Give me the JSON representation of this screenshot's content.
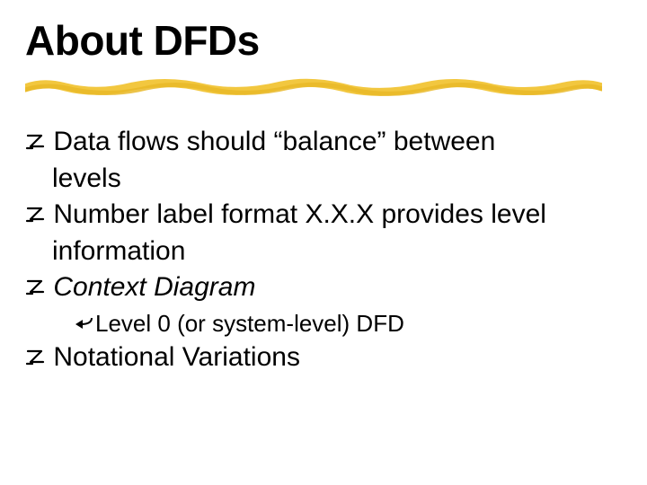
{
  "title": "About DFDs",
  "bullets": [
    {
      "text": "Data flows should “balance” between",
      "indentContinuation": "levels",
      "italic": false
    },
    {
      "text": "Number label format X.X.X provides level",
      "indentContinuation": "information",
      "italic": false
    },
    {
      "text": "Context Diagram",
      "italic": true,
      "sub": [
        "Level 0 (or system-level) DFD"
      ]
    },
    {
      "text": "Notational Variations",
      "italic": false
    }
  ],
  "icons": {
    "topBullet": "z-glyph",
    "subBullet": "back-arrow"
  }
}
